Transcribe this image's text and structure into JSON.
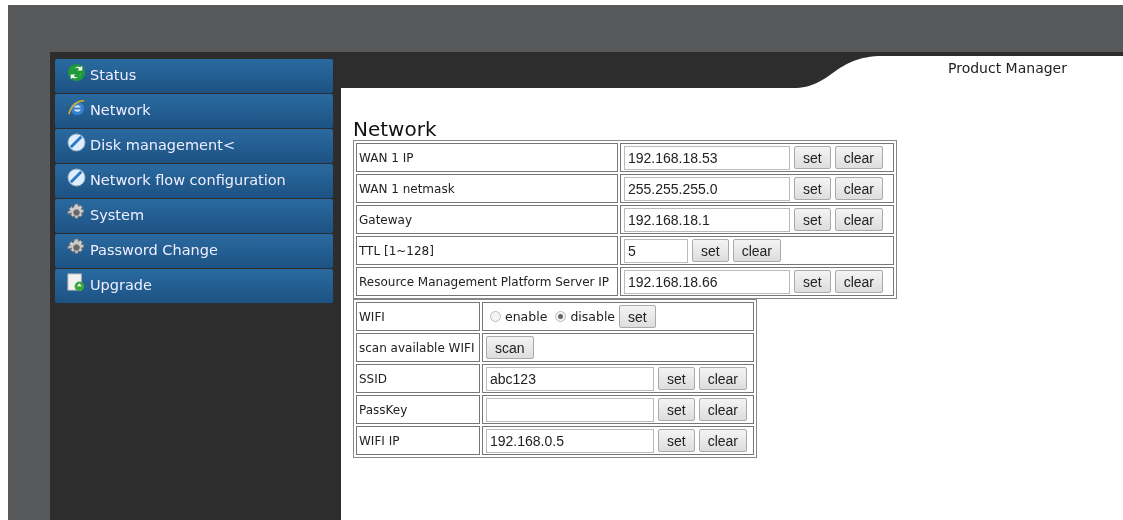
{
  "header": {
    "title": "Product Manager"
  },
  "sidebar": {
    "items": [
      {
        "label": "Status",
        "kind": "recycle"
      },
      {
        "label": "Network",
        "kind": "globe"
      },
      {
        "label": "Disk management<",
        "kind": "disk"
      },
      {
        "label": "Network flow configuration",
        "kind": "disk"
      },
      {
        "label": "System",
        "kind": "gear"
      },
      {
        "label": "Password Change",
        "kind": "gear"
      },
      {
        "label": "Upgrade",
        "kind": "upgrade"
      }
    ]
  },
  "page_title": "Network",
  "network_table": {
    "rows": [
      {
        "kind": "field",
        "label": "WAN 1 IP",
        "value": "192.168.18.53",
        "buttons": [
          "set",
          "clear"
        ]
      },
      {
        "kind": "field",
        "label": "WAN 1 netmask",
        "value": "255.255.255.0",
        "buttons": [
          "set",
          "clear"
        ]
      },
      {
        "kind": "field",
        "label": "Gateway",
        "value": "192.168.18.1",
        "buttons": [
          "set",
          "clear"
        ]
      },
      {
        "kind": "short_field",
        "label": "TTL [1~128]",
        "value": "5",
        "buttons": [
          "set",
          "clear"
        ]
      },
      {
        "kind": "field",
        "label": "Resource Management Platform Server IP",
        "value": "192.168.18.66",
        "buttons": [
          "set",
          "clear"
        ]
      }
    ]
  },
  "wifi_table": {
    "rows": [
      {
        "kind": "radio",
        "label": "WIFI",
        "options": [
          {
            "label": "enable",
            "selected": false
          },
          {
            "label": "disable",
            "selected": true
          }
        ],
        "buttons": [
          "set"
        ]
      },
      {
        "kind": "button",
        "label": "scan available WIFI",
        "buttons": [
          "scan"
        ]
      },
      {
        "kind": "field",
        "label": "SSID",
        "value": "abc123",
        "buttons": [
          "set",
          "clear"
        ]
      },
      {
        "kind": "field",
        "label": "PassKey",
        "buttons": [
          "set",
          "clear"
        ]
      },
      {
        "kind": "field",
        "label": "WIFI IP",
        "value": "192.168.0.5",
        "buttons": [
          "set",
          "clear"
        ]
      }
    ]
  }
}
